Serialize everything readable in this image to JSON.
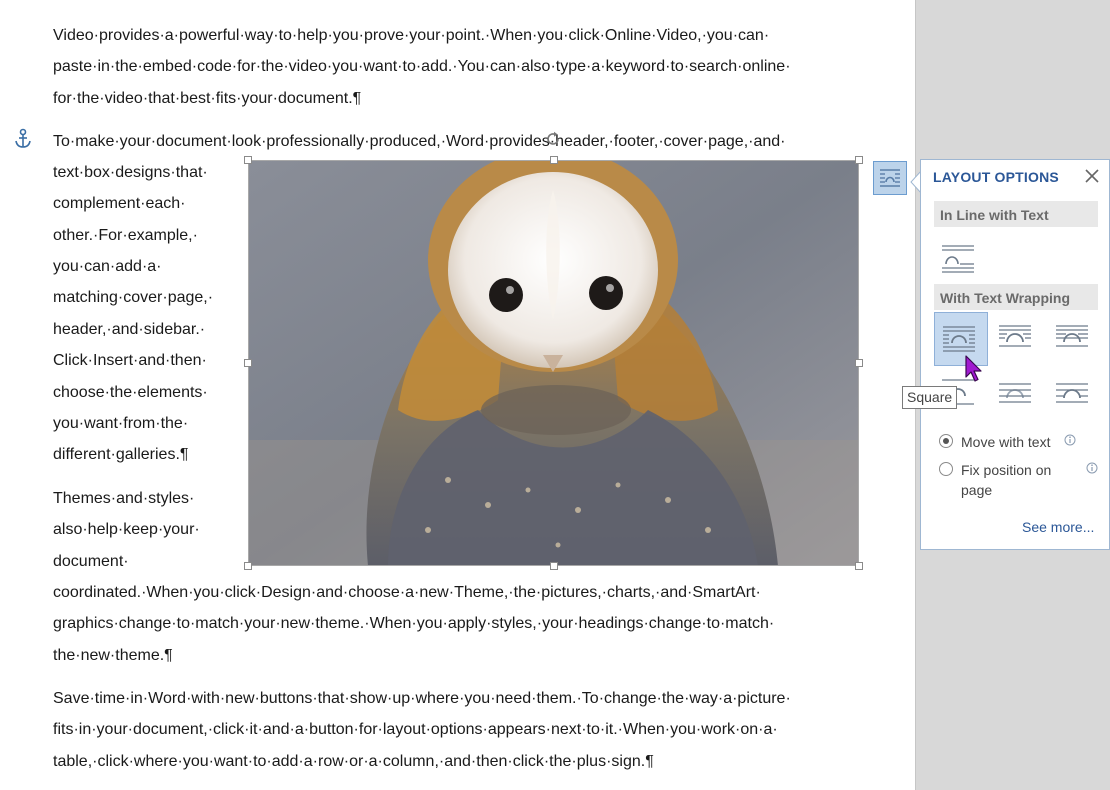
{
  "document": {
    "lines": [
      "Video·provides·a·powerful·way·to·help·you·prove·your·point.·When·you·click·Online·Video,·you·can·",
      "paste·in·the·embed·code·for·the·video·you·want·to·add.·You·can·also·type·a·keyword·to·search·online·",
      "for·the·video·that·best·fits·your·document.¶",
      "To·make·your·document·look·professionally·produced,·Word·provides·header,·footer,·cover·page,·and·",
      "text·box·designs·that·",
      "complement·each·",
      "other.·For·example,·",
      "you·can·add·a·",
      "matching·cover·page,·",
      "header,·and·sidebar.·",
      "Click·Insert·and·then·",
      "choose·the·elements·",
      "you·want·from·the·",
      "different·galleries.¶",
      "Themes·and·styles·",
      "also·help·keep·your·",
      "document·",
      "coordinated.·When·you·click·Design·and·choose·a·new·Theme,·the·pictures,·charts,·and·SmartArt·",
      "graphics·change·to·match·your·new·theme.·When·you·apply·styles,·your·headings·change·to·match·",
      "the·new·theme.¶",
      "Save·time·in·Word·with·new·buttons·that·show·up·where·you·need·them.·To·change·the·way·a·picture·",
      "fits·in·your·document,·click·it·and·a·button·for·layout·options·appears·next·to·it.·When·you·work·on·a·",
      "table,·click·where·you·want·to·add·a·row·or·a·column,·and·then·click·the·plus·sign.¶"
    ]
  },
  "layout_panel": {
    "title": "LAYOUT OPTIONS",
    "inline_heading": "In Line with Text",
    "wrapping_heading": "With Text Wrapping",
    "wrap_options": [
      "square",
      "tight",
      "through",
      "top-and-bottom",
      "behind-text",
      "in-front-of-text"
    ],
    "selected_option": "square",
    "move_with_text": "Move with text",
    "fix_position": "Fix position on page",
    "move_selected": true,
    "see_more": "See more..."
  },
  "tooltip": "Square",
  "colors": {
    "accent": "#2b5797",
    "button_bg": "#bcd3ea",
    "selected_bg": "#c5d9ef",
    "cursor": "#a01ad0"
  },
  "icons": [
    "anchor-icon",
    "rotate-icon",
    "layout-options-icon",
    "close-icon",
    "info-icon",
    "mouse-cursor-icon"
  ]
}
